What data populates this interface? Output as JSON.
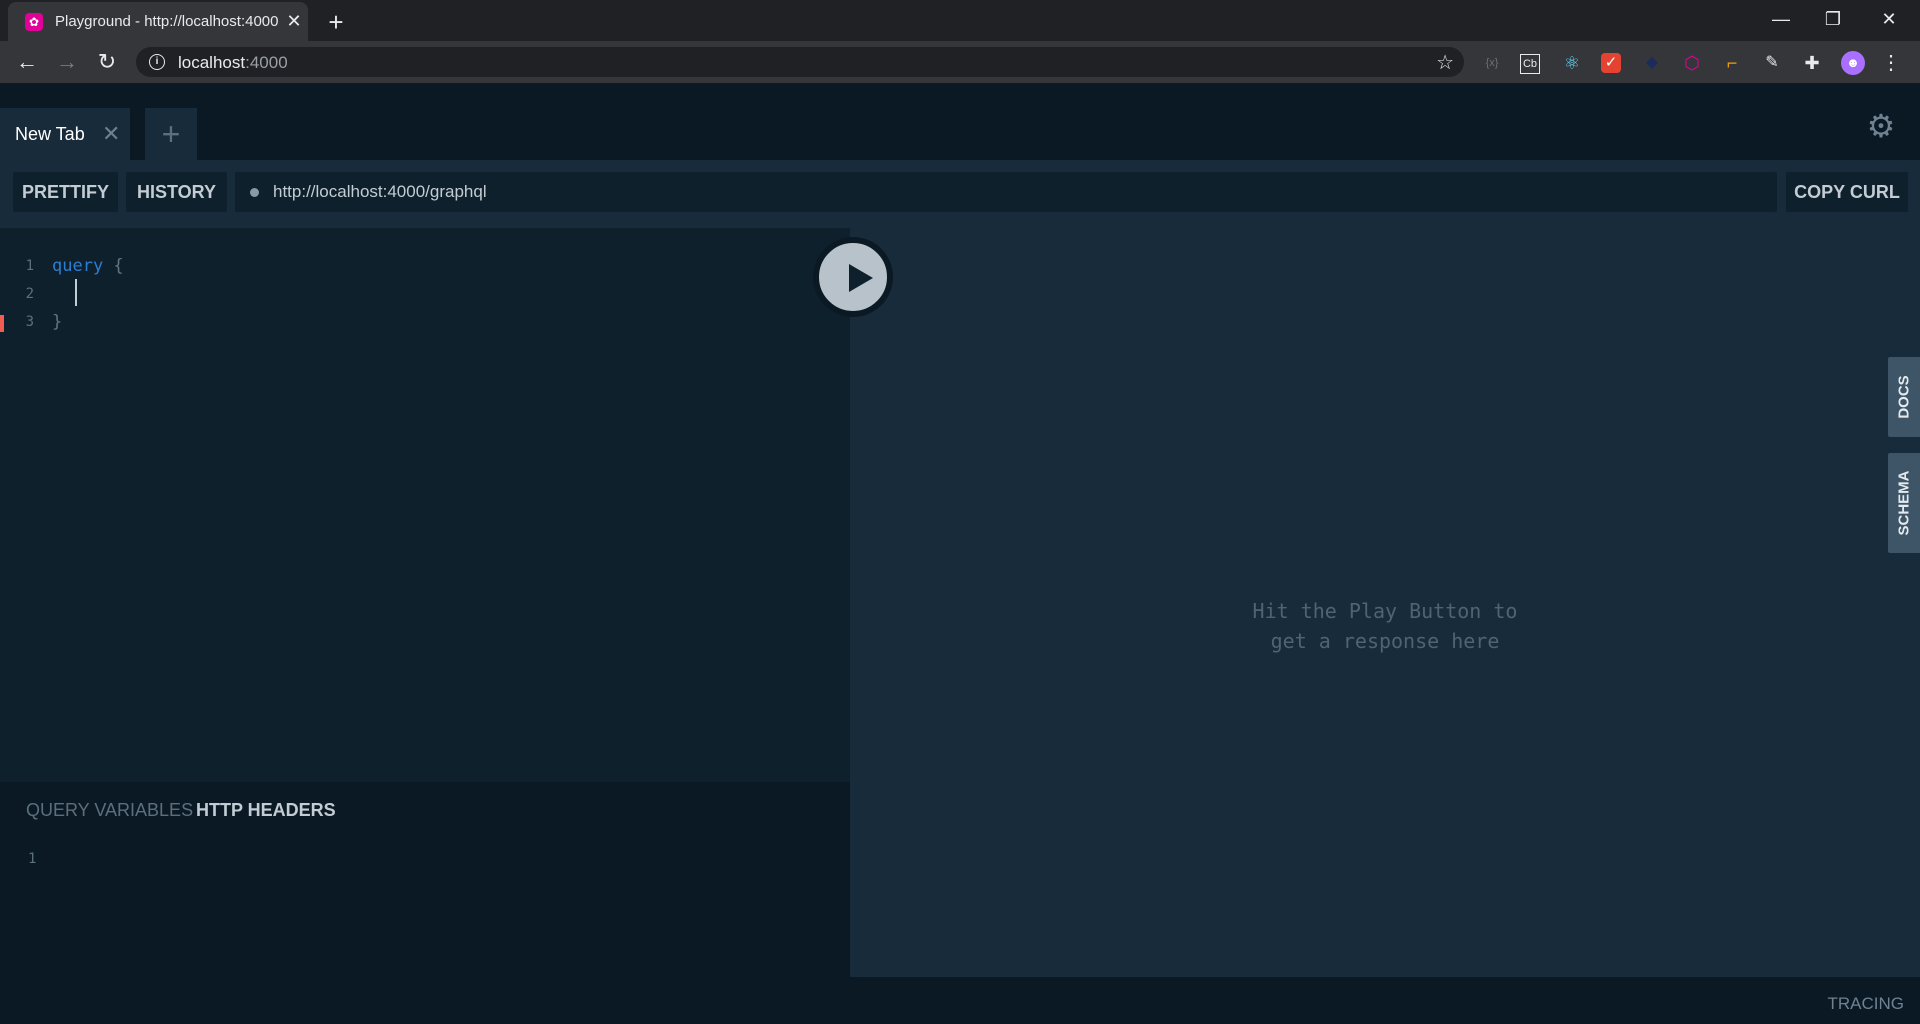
{
  "browser": {
    "tab_title": "Playground - http://localhost:4000",
    "url_host": "localhost",
    "url_port": ":4000",
    "new_tab_symbol": "+",
    "tab_close_symbol": "✕",
    "window_controls": {
      "minimize": "—",
      "restore": "❐",
      "close": "✕"
    },
    "extensions": [
      "json-viewer-icon",
      "cb-icon",
      "react-devtools-icon",
      "todoist-icon",
      "dark-icon",
      "graphql-icon",
      "measure-icon",
      "pen-icon",
      "puzzle-icon",
      "profile-avatar"
    ]
  },
  "playground": {
    "tab_label": "New Tab",
    "add_tab_symbol": "+",
    "prettify": "PRETTIFY",
    "history": "HISTORY",
    "endpoint": "http://localhost:4000/graphql",
    "copy_curl": "COPY CURL",
    "editor": {
      "lines": [
        {
          "num": "1",
          "keyword": "query",
          "punct": " {"
        },
        {
          "num": "2",
          "keyword": "",
          "punct": ""
        },
        {
          "num": "3",
          "keyword": "",
          "punct": "}"
        }
      ]
    },
    "result_placeholder_line1": "Hit the Play Button to",
    "result_placeholder_line2": "get a response here",
    "query_variables_tab": "QUERY VARIABLES",
    "http_headers_tab": "HTTP HEADERS",
    "vars_line_num": "1",
    "docs_tab": "DOCS",
    "schema_tab": "SCHEMA",
    "tracing": "TRACING"
  },
  "colors": {
    "accent_graphql": "#e10098",
    "keyword": "#2a7ed2",
    "error_marker": "#f25c54"
  }
}
